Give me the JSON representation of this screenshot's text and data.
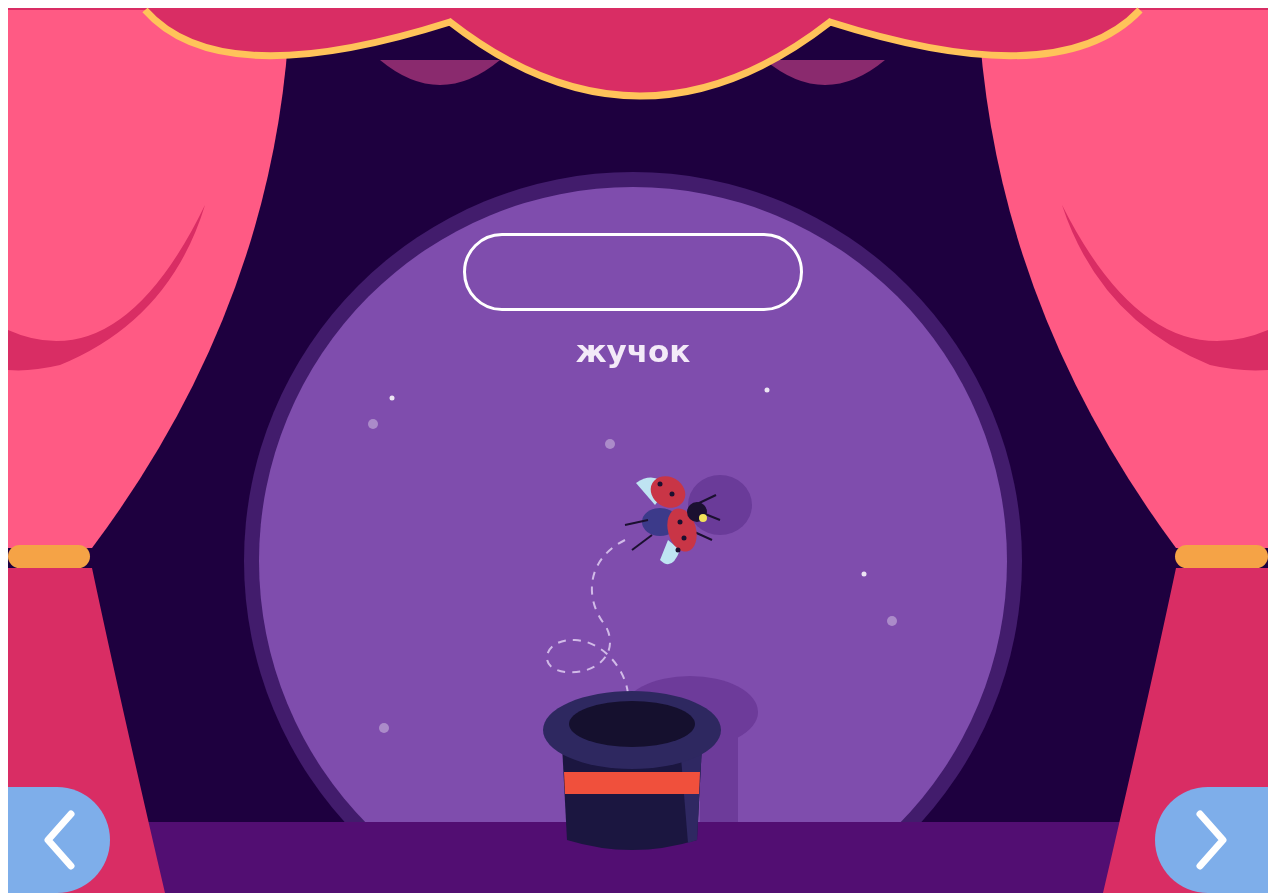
{
  "word": "жучок"
}
